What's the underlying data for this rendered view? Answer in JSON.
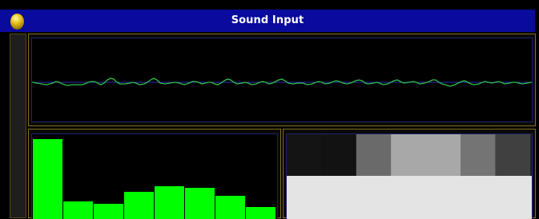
{
  "window": {
    "title": "Sound Input",
    "icon": "orb-icon"
  },
  "colors": {
    "titlebar": "#0a0a9e",
    "panel_border": "#8a6f1e",
    "waveform": "#2fbf4a",
    "bars": "#00ff00"
  },
  "spectrum": {
    "levels": [
      0.94,
      0.21,
      0.18,
      0.32,
      0.39,
      0.37,
      0.27,
      0.14
    ]
  },
  "tones": {
    "upper": [
      "#141414",
      "#121212",
      "#6a6a6a",
      "#a8a8a8",
      "#a8a8a8",
      "#747474",
      "#404040"
    ],
    "lower": "#e4e4e4"
  }
}
